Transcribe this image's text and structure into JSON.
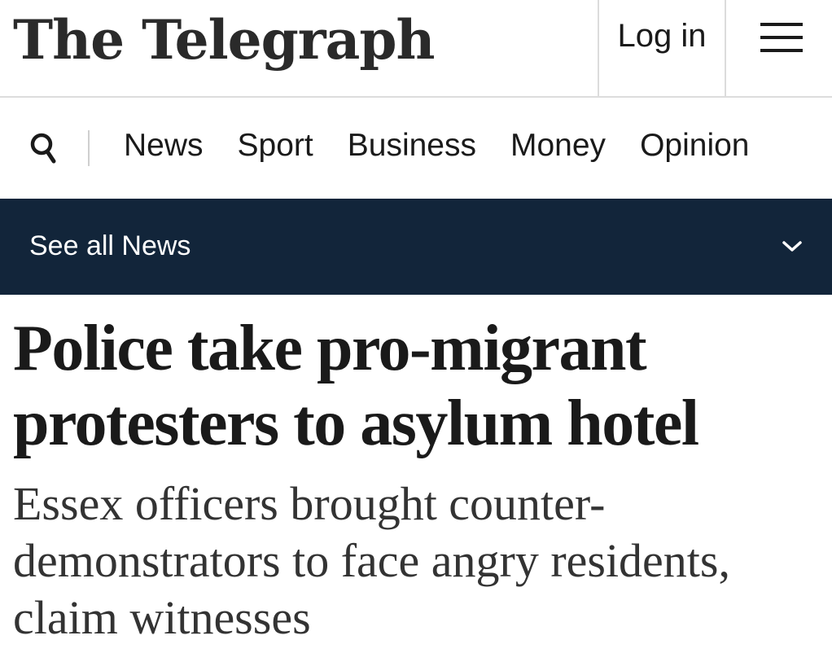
{
  "masthead": {
    "logo_text": "The Telegraph",
    "login_label": "Log in",
    "menu_icon": "hamburger-menu-icon"
  },
  "nav": {
    "search_icon": "search-icon",
    "items": [
      "News",
      "Sport",
      "Business",
      "Money",
      "Opinion"
    ]
  },
  "section_bar": {
    "label": "See all News",
    "icon": "chevron-down-icon",
    "background": "#12253a"
  },
  "article": {
    "headline": "Police take pro-migrant protesters to asylum hotel",
    "standfirst": "Essex officers brought counter-demonstrators to face angry residents, claim witnesses"
  }
}
